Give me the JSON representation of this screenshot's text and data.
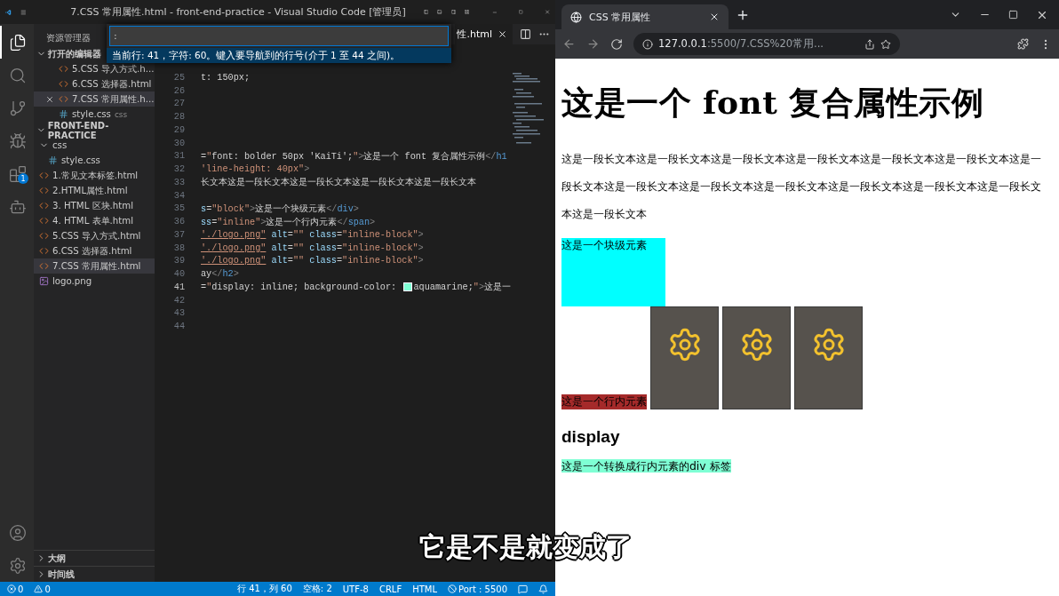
{
  "vscode": {
    "title": "7.CSS 常用属性.html - front-end-practice - Visual Studio Code [管理员]",
    "activity_bar": [
      {
        "kind": "explorer",
        "selected": true
      },
      {
        "kind": "search",
        "selected": false
      },
      {
        "kind": "source-control",
        "selected": false
      },
      {
        "kind": "debug",
        "selected": false
      },
      {
        "kind": "extensions",
        "selected": false,
        "badge": "1"
      },
      {
        "kind": "robot",
        "selected": false
      }
    ],
    "activity_bar_bottom": [
      {
        "kind": "account"
      },
      {
        "kind": "settings"
      }
    ],
    "sidebar": {
      "title": "资源管理器",
      "open_editors": {
        "label": "打开的编辑器",
        "expanded": true,
        "items": [
          {
            "label": "5.CSS 导入方式.h...",
            "kind": "html",
            "selected": false
          },
          {
            "label": "6.CSS 选择器.html",
            "kind": "html",
            "selected": false
          },
          {
            "label": "7.CSS 常用属性.h...",
            "kind": "html",
            "selected": true
          },
          {
            "label": "style.css",
            "kind": "css",
            "selected": false,
            "description": "css"
          }
        ]
      },
      "project": {
        "label": "FRONT-END-PRACTICE",
        "expanded": true,
        "children": [
          {
            "label": "css",
            "kind": "folder",
            "expanded": true,
            "selected": false,
            "children": [
              {
                "label": "style.css",
                "kind": "css",
                "selected": false
              }
            ]
          },
          {
            "label": "1.常见文本标签.html",
            "kind": "html",
            "selected": false
          },
          {
            "label": "2.HTML属性.html",
            "kind": "html",
            "selected": false
          },
          {
            "label": "3. HTML 区块.html",
            "kind": "html",
            "selected": false
          },
          {
            "label": "4. HTML 表单.html",
            "kind": "html",
            "selected": false
          },
          {
            "label": "5.CSS 导入方式.html",
            "kind": "html",
            "selected": false
          },
          {
            "label": "6.CSS 选择器.html",
            "kind": "html",
            "selected": false
          },
          {
            "label": "7.CSS 常用属性.html",
            "kind": "html",
            "selected": true
          },
          {
            "label": "logo.png",
            "kind": "image",
            "selected": false
          }
        ]
      },
      "bottom_sections": [
        {
          "label": "大纲",
          "expanded": false
        },
        {
          "label": "时间线",
          "expanded": false
        }
      ]
    },
    "quick_input": {
      "value": ":",
      "message": "当前行: 41，字符: 60。键入要导航到的行号(介于 1 至 44 之间)。"
    },
    "editor_tab": {
      "label": "性.html"
    },
    "code_lines": [
      {
        "number": "25",
        "current": false,
        "tokens": [
          {
            "kind": "plain",
            "text": "t: 150px;"
          }
        ]
      },
      {
        "number": "26",
        "current": false
      },
      {
        "number": "27",
        "current": false
      },
      {
        "number": "28",
        "current": false
      },
      {
        "number": "29",
        "current": false
      },
      {
        "number": "30",
        "current": false
      },
      {
        "number": "31",
        "current": false,
        "tokens": [
          {
            "kind": "plain",
            "text": "="
          },
          {
            "kind": "string",
            "text": "\""
          },
          {
            "kind": "plain",
            "text": "font: bolder 50px 'KaiTi';"
          },
          {
            "kind": "string",
            "text": "\""
          },
          {
            "kind": "punct",
            "text": ">"
          },
          {
            "kind": "plain",
            "text": "这是一个 font 复合属性示例"
          },
          {
            "kind": "punct",
            "text": "</"
          },
          {
            "kind": "tag",
            "text": "h1"
          }
        ]
      },
      {
        "number": "32",
        "current": false,
        "tokens": [
          {
            "kind": "string",
            "text": "'line-height: 40px\""
          },
          {
            "kind": "punct",
            "text": ">"
          }
        ]
      },
      {
        "number": "33",
        "current": false,
        "tokens": [
          {
            "kind": "plain",
            "text": "长文本这是一段长文本这是一段长文本这是一段长文本这是一段长文本"
          }
        ]
      },
      {
        "number": "34",
        "current": false
      },
      {
        "number": "35",
        "current": false,
        "tokens": [
          {
            "kind": "attr",
            "text": "s"
          },
          {
            "kind": "plain",
            "text": "="
          },
          {
            "kind": "string",
            "text": "\"block\""
          },
          {
            "kind": "punct",
            "text": ">"
          },
          {
            "kind": "plain",
            "text": "这是一个块级元素"
          },
          {
            "kind": "punct",
            "text": "</"
          },
          {
            "kind": "tag",
            "text": "div"
          },
          {
            "kind": "punct",
            "text": ">"
          }
        ]
      },
      {
        "number": "36",
        "current": false,
        "tokens": [
          {
            "kind": "attr",
            "text": "ss"
          },
          {
            "kind": "plain",
            "text": "="
          },
          {
            "kind": "string",
            "text": "\"inline\""
          },
          {
            "kind": "punct",
            "text": ">"
          },
          {
            "kind": "plain",
            "text": "这是一个行内元素"
          },
          {
            "kind": "punct",
            "text": "</"
          },
          {
            "kind": "tag",
            "text": "span"
          },
          {
            "kind": "punct",
            "text": ">"
          }
        ]
      },
      {
        "number": "37",
        "current": false,
        "tokens": [
          {
            "kind": "link",
            "text": "'./logo.png\""
          },
          {
            "kind": "attr",
            "text": " alt"
          },
          {
            "kind": "plain",
            "text": "="
          },
          {
            "kind": "string",
            "text": "\"\""
          },
          {
            "kind": "attr",
            "text": " class"
          },
          {
            "kind": "plain",
            "text": "="
          },
          {
            "kind": "string",
            "text": "\"inline-block\""
          },
          {
            "kind": "punct",
            "text": ">"
          }
        ]
      },
      {
        "number": "38",
        "current": false,
        "tokens": [
          {
            "kind": "link",
            "text": "'./logo.png\""
          },
          {
            "kind": "attr",
            "text": " alt"
          },
          {
            "kind": "plain",
            "text": "="
          },
          {
            "kind": "string",
            "text": "\"\""
          },
          {
            "kind": "attr",
            "text": " class"
          },
          {
            "kind": "plain",
            "text": "="
          },
          {
            "kind": "string",
            "text": "\"inline-block\""
          },
          {
            "kind": "punct",
            "text": ">"
          }
        ]
      },
      {
        "number": "39",
        "current": false,
        "tokens": [
          {
            "kind": "link",
            "text": "'./logo.png\""
          },
          {
            "kind": "attr",
            "text": " alt"
          },
          {
            "kind": "plain",
            "text": "="
          },
          {
            "kind": "string",
            "text": "\"\""
          },
          {
            "kind": "attr",
            "text": " class"
          },
          {
            "kind": "plain",
            "text": "="
          },
          {
            "kind": "string",
            "text": "\"inline-block\""
          },
          {
            "kind": "punct",
            "text": ">"
          }
        ]
      },
      {
        "number": "40",
        "current": false,
        "tokens": [
          {
            "kind": "plain",
            "text": "ay"
          },
          {
            "kind": "punct",
            "text": "</"
          },
          {
            "kind": "tag",
            "text": "h2"
          },
          {
            "kind": "punct",
            "text": ">"
          }
        ]
      },
      {
        "number": "41",
        "current": true,
        "tokens": [
          {
            "kind": "plain",
            "text": "="
          },
          {
            "kind": "string",
            "text": "\""
          },
          {
            "kind": "plain",
            "text": "display: inline; background-color: "
          },
          {
            "kind": "swatch",
            "color": "#7fffd4"
          },
          {
            "kind": "plain",
            "text": "aquamarine;"
          },
          {
            "kind": "string",
            "text": "\""
          },
          {
            "kind": "punct",
            "text": ">"
          },
          {
            "kind": "plain",
            "text": "这是一"
          }
        ]
      },
      {
        "number": "42",
        "current": false
      },
      {
        "number": "43",
        "current": false
      },
      {
        "number": "44",
        "current": false
      }
    ],
    "status_bar": {
      "errors": "0",
      "warnings": "0",
      "items": [
        {
          "kind": "text",
          "label": "行 41，列 60"
        },
        {
          "kind": "text",
          "label": "空格: 2"
        },
        {
          "kind": "text",
          "label": "UTF-8"
        },
        {
          "kind": "text",
          "label": "CRLF"
        },
        {
          "kind": "text",
          "label": "HTML"
        },
        {
          "kind": "port",
          "label": "Port : 5500"
        }
      ]
    }
  },
  "browser": {
    "tab": {
      "title": "CSS 常用属性"
    },
    "url": {
      "host": "127.0.0.1",
      "path": ":5500/7.CSS%20常用..."
    },
    "page": {
      "heading": "这是一个 font 复合属性示例",
      "paragraph": "这是一段长文本这是一段长文本这是一段长文本这是一段长文本这是一段长文本这是一段长文本这是一段长文本这是一段长文本这是一段长文本这是一段长文本这是一段长文本这是一段长文本这是一段长文本这是一段长文本",
      "block_text": "这是一个块级元素",
      "inline_text": "这是一个行内元素",
      "images": [
        {
          "kind": "logo"
        },
        {
          "kind": "logo"
        },
        {
          "kind": "logo"
        }
      ],
      "subheading": "display",
      "inline_block_text": "这是一个转换成行内元素的div 标签"
    }
  },
  "subtitle": "它是不是就变成了"
}
